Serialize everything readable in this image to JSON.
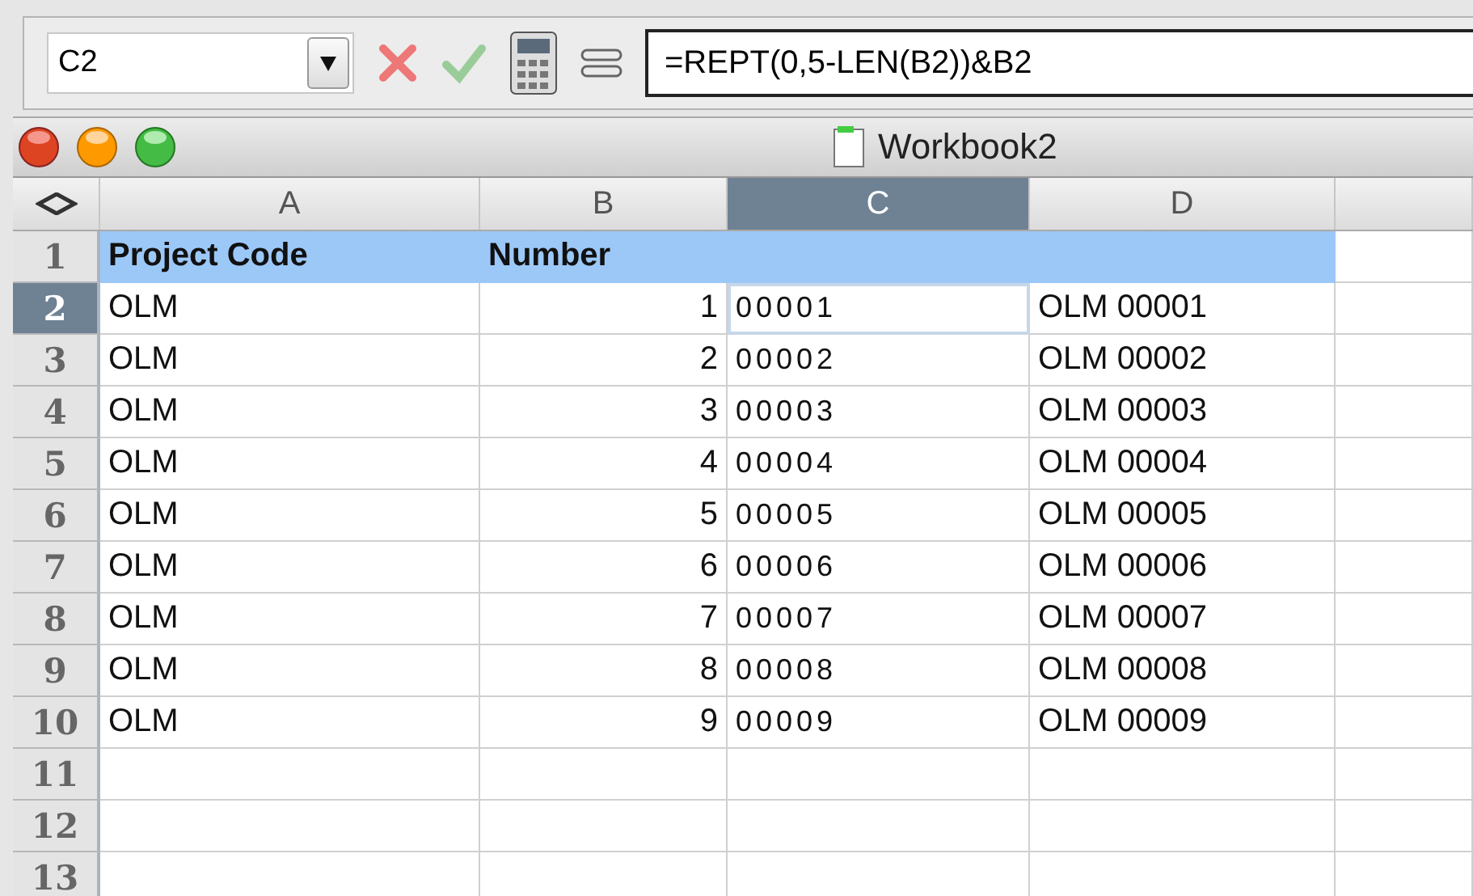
{
  "formula_bar": {
    "name_box": "C2",
    "formula": "=REPT(0,5-LEN(B2))&B2"
  },
  "window": {
    "title": "Workbook2"
  },
  "columns": [
    {
      "label": "A",
      "selected": false
    },
    {
      "label": "B",
      "selected": false
    },
    {
      "label": "C",
      "selected": true
    },
    {
      "label": "D",
      "selected": false
    }
  ],
  "rows": [
    {
      "label": "1",
      "selected": false,
      "highlighted": true,
      "cells": [
        {
          "text": "Project Code",
          "kind": "header"
        },
        {
          "text": "Number",
          "kind": "header"
        }
      ]
    },
    {
      "label": "2",
      "selected": true,
      "highlighted": false,
      "cells": [
        {
          "text": "OLM",
          "kind": "text"
        },
        {
          "text": "1",
          "kind": "number"
        },
        {
          "text": "00001",
          "kind": "spaced"
        },
        {
          "text": "OLM 00001",
          "kind": "text"
        }
      ]
    },
    {
      "label": "3",
      "selected": false,
      "highlighted": false,
      "cells": [
        {
          "text": "OLM",
          "kind": "text"
        },
        {
          "text": "2",
          "kind": "number"
        },
        {
          "text": "00002",
          "kind": "spaced"
        },
        {
          "text": "OLM 00002",
          "kind": "text"
        }
      ]
    },
    {
      "label": "4",
      "selected": false,
      "highlighted": false,
      "cells": [
        {
          "text": "OLM",
          "kind": "text"
        },
        {
          "text": "3",
          "kind": "number"
        },
        {
          "text": "00003",
          "kind": "spaced"
        },
        {
          "text": "OLM 00003",
          "kind": "text"
        }
      ]
    },
    {
      "label": "5",
      "selected": false,
      "highlighted": false,
      "cells": [
        {
          "text": "OLM",
          "kind": "text"
        },
        {
          "text": "4",
          "kind": "number"
        },
        {
          "text": "00004",
          "kind": "spaced"
        },
        {
          "text": "OLM 00004",
          "kind": "text"
        }
      ]
    },
    {
      "label": "6",
      "selected": false,
      "highlighted": false,
      "cells": [
        {
          "text": "OLM",
          "kind": "text"
        },
        {
          "text": "5",
          "kind": "number"
        },
        {
          "text": "00005",
          "kind": "spaced"
        },
        {
          "text": "OLM 00005",
          "kind": "text"
        }
      ]
    },
    {
      "label": "7",
      "selected": false,
      "highlighted": false,
      "cells": [
        {
          "text": "OLM",
          "kind": "text"
        },
        {
          "text": "6",
          "kind": "number"
        },
        {
          "text": "00006",
          "kind": "spaced"
        },
        {
          "text": "OLM 00006",
          "kind": "text"
        }
      ]
    },
    {
      "label": "8",
      "selected": false,
      "highlighted": false,
      "cells": [
        {
          "text": "OLM",
          "kind": "text"
        },
        {
          "text": "7",
          "kind": "number"
        },
        {
          "text": "00007",
          "kind": "spaced"
        },
        {
          "text": "OLM 00007",
          "kind": "text"
        }
      ]
    },
    {
      "label": "9",
      "selected": false,
      "highlighted": false,
      "cells": [
        {
          "text": "OLM",
          "kind": "text"
        },
        {
          "text": "8",
          "kind": "number"
        },
        {
          "text": "00008",
          "kind": "spaced"
        },
        {
          "text": "OLM 00008",
          "kind": "text"
        }
      ]
    },
    {
      "label": "10",
      "selected": false,
      "highlighted": false,
      "cells": [
        {
          "text": "OLM",
          "kind": "text"
        },
        {
          "text": "9",
          "kind": "number"
        },
        {
          "text": "00009",
          "kind": "spaced"
        },
        {
          "text": "OLM 00009",
          "kind": "text"
        }
      ]
    },
    {
      "label": "11",
      "selected": false,
      "highlighted": false
    },
    {
      "label": "12",
      "selected": false,
      "highlighted": false
    },
    {
      "label": "13",
      "selected": false,
      "highlighted": false
    }
  ]
}
